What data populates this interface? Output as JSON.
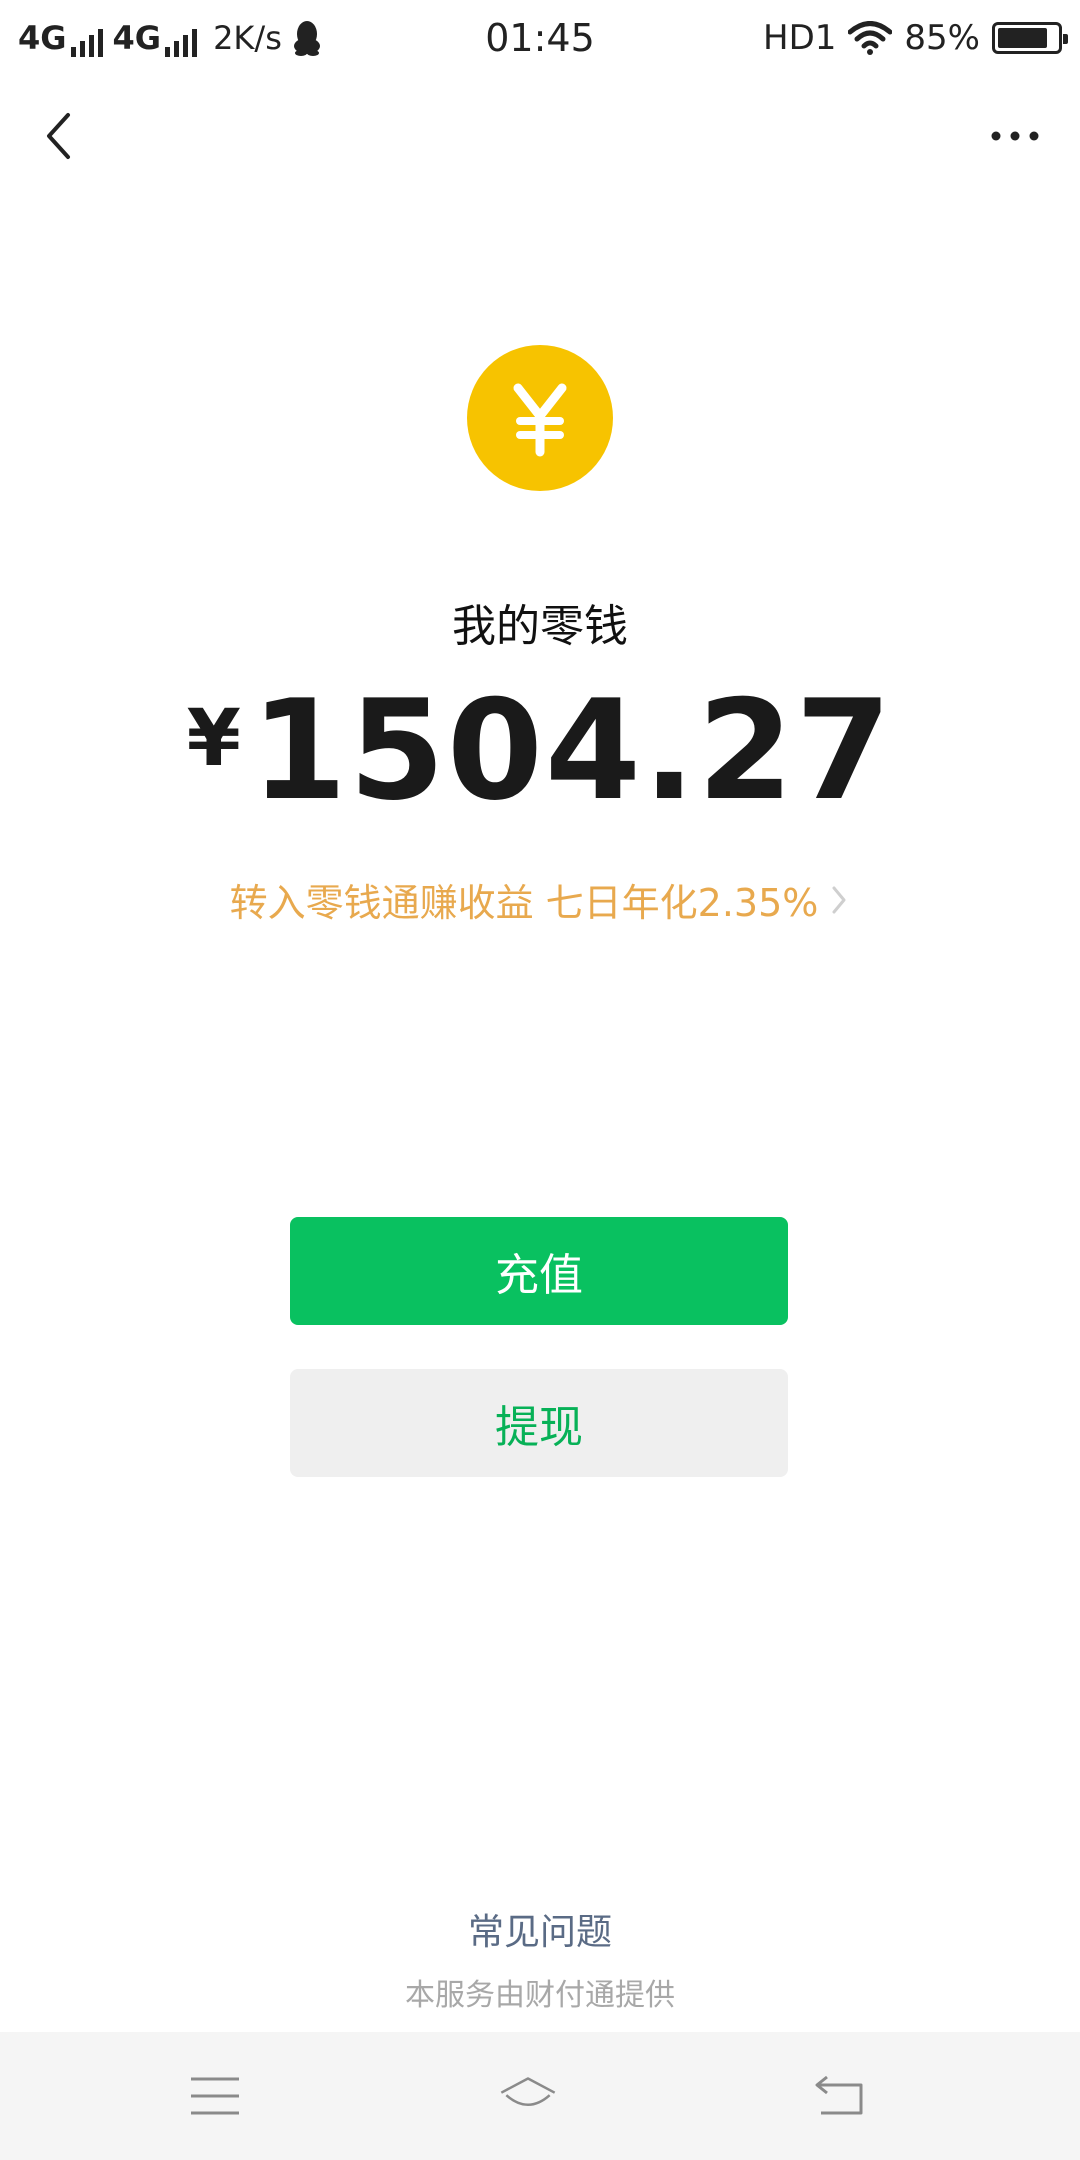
{
  "status_bar": {
    "net1": "4G",
    "net2": "4G",
    "speed": "2K/s",
    "time": "01:45",
    "hd": "HD1",
    "battery_percent": "85%",
    "battery_level": 0.85
  },
  "nav": {
    "back_icon": "chevron-left-icon",
    "more_icon": "more-dots-icon"
  },
  "wallet": {
    "coin_icon": "yuan-coin-icon",
    "title": "我的零钱",
    "currency_symbol": "¥",
    "amount": "1504.27",
    "promo": "转入零钱通赚收益 七日年化2.35%",
    "primary_button": "充值",
    "secondary_button": "提现",
    "faq": "常见问题",
    "provider": "本服务由财付通提供"
  },
  "colors": {
    "coin": "#f7c300",
    "primary": "#09c160",
    "promo": "#e8a94e",
    "faq": "#5a6b85"
  },
  "sysnav": {
    "menu_icon": "menu-icon",
    "home_icon": "home-icon",
    "back_icon": "back-return-icon"
  }
}
